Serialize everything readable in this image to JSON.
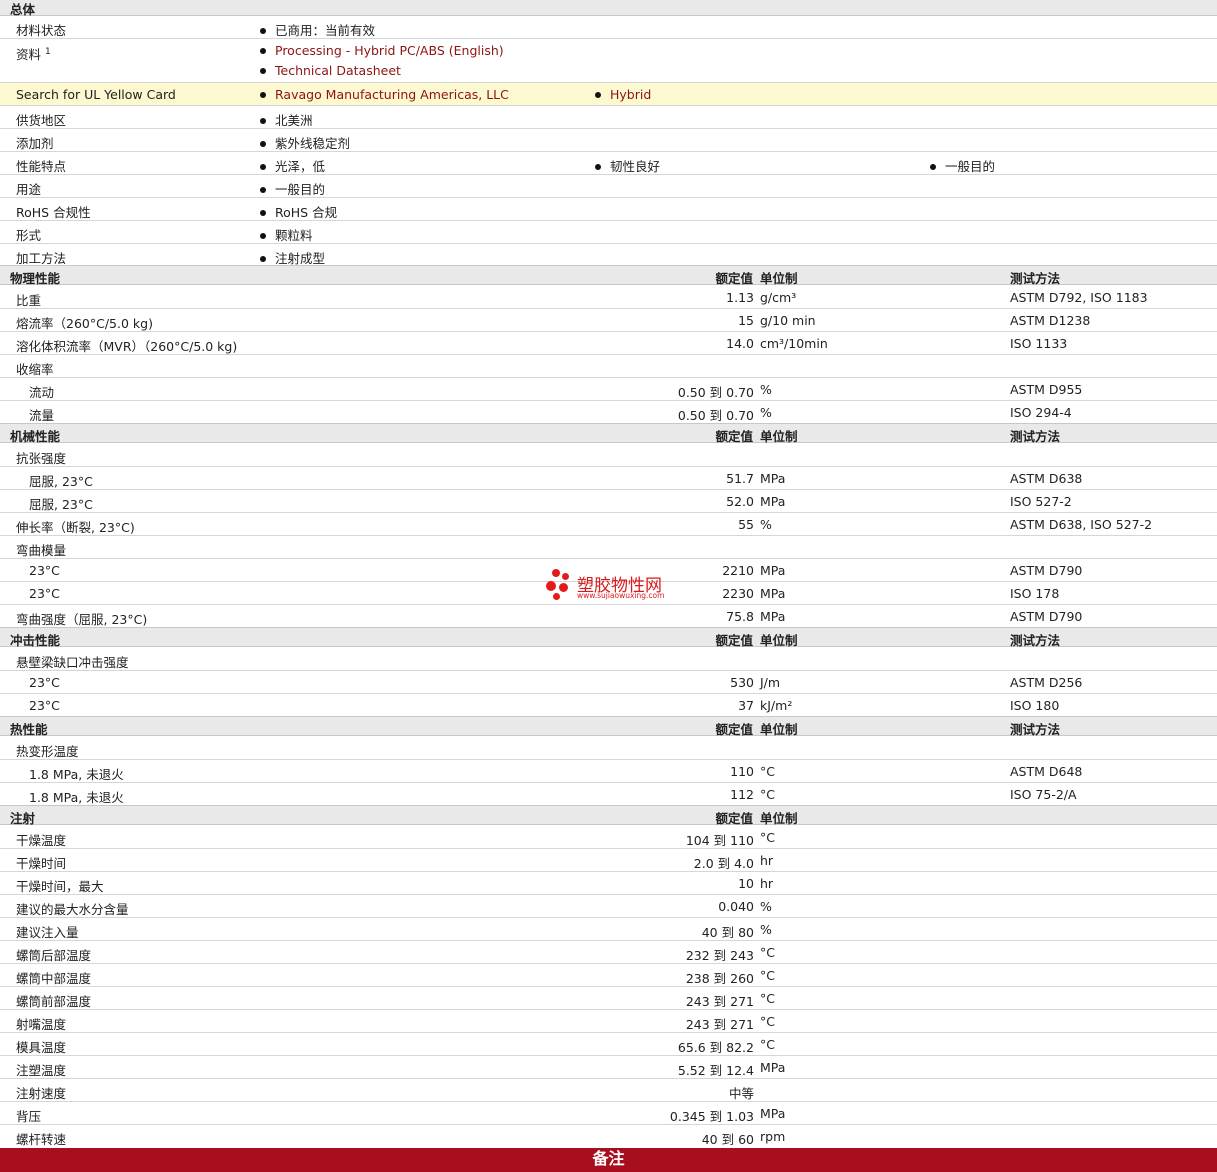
{
  "general": {
    "title": "总体",
    "material_status_label": "材料状态",
    "material_status_value": "已商用：当前有效",
    "docs_label": "资料",
    "docs_sup": "1",
    "docs": [
      "Processing - Hybrid PC/ABS (English)",
      "Technical Datasheet"
    ],
    "ul_label": "Search for UL Yellow Card",
    "ul_items": [
      "Ravago Manufacturing Americas, LLC",
      "Hybrid"
    ],
    "region_label": "供货地区",
    "region_value": "北美洲",
    "additive_label": "添加剂",
    "additive_value": "紫外线稳定剂",
    "features_label": "性能特点",
    "features": [
      "光泽，低",
      "韧性良好",
      "一般目的"
    ],
    "uses_label": "用途",
    "uses_value": "一般目的",
    "rohs_label": "RoHS 合规性",
    "rohs_value": "RoHS 合规",
    "form_label": "形式",
    "form_value": "颗粒料",
    "process_label": "加工方法",
    "process_value": "注射成型"
  },
  "headers": {
    "value": "额定值",
    "unit": "单位制",
    "method": "测试方法"
  },
  "physical": {
    "title": "物理性能",
    "rows": [
      {
        "label": "比重",
        "value": "1.13",
        "unit": "g/cm³",
        "method": "ASTM D792, ISO 1183"
      },
      {
        "label": "熔流率（260°C/5.0 kg)",
        "value": "15",
        "unit": "g/10 min",
        "method": "ASTM D1238"
      },
      {
        "label": "溶化体积流率（MVR）（260°C/5.0 kg)",
        "value": "14.0",
        "unit": "cm³/10min",
        "method": "ISO 1133"
      },
      {
        "label": "收缩率",
        "value": "",
        "unit": "",
        "method": ""
      },
      {
        "label": "流动",
        "value": "0.50 到  0.70",
        "unit": "%",
        "method": "ASTM D955"
      },
      {
        "label": "流量",
        "value": "0.50 到  0.70",
        "unit": "%",
        "method": "ISO 294-4"
      }
    ]
  },
  "mechanical": {
    "title": "机械性能",
    "rows": [
      {
        "label": "抗张强度",
        "value": "",
        "unit": "",
        "method": ""
      },
      {
        "label": "屈服, 23°C",
        "value": "51.7",
        "unit": "MPa",
        "method": "ASTM D638"
      },
      {
        "label": "屈服, 23°C",
        "value": "52.0",
        "unit": "MPa",
        "method": "ISO 527-2"
      },
      {
        "label": "伸长率（断裂, 23°C)",
        "value": "55",
        "unit": "%",
        "method": "ASTM D638, ISO 527-2"
      },
      {
        "label": "弯曲模量",
        "value": "",
        "unit": "",
        "method": ""
      },
      {
        "label": "23°C",
        "value": "2210",
        "unit": "MPa",
        "method": "ASTM D790"
      },
      {
        "label": "23°C",
        "value": "2230",
        "unit": "MPa",
        "method": "ISO 178"
      },
      {
        "label": "弯曲强度（屈服, 23°C)",
        "value": "75.8",
        "unit": "MPa",
        "method": "ASTM D790"
      }
    ]
  },
  "impact": {
    "title": "冲击性能",
    "rows": [
      {
        "label": "悬壁梁缺口冲击强度",
        "value": "",
        "unit": "",
        "method": ""
      },
      {
        "label": "23°C",
        "value": "530",
        "unit": "J/m",
        "method": "ASTM D256"
      },
      {
        "label": "23°C",
        "value": "37",
        "unit": "kJ/m²",
        "method": "ISO 180"
      }
    ]
  },
  "thermal": {
    "title": "热性能",
    "rows": [
      {
        "label": "热变形温度",
        "value": "",
        "unit": "",
        "method": ""
      },
      {
        "label": "1.8 MPa, 未退火",
        "value": "110",
        "unit": "°C",
        "method": "ASTM D648"
      },
      {
        "label": "1.8 MPa, 未退火",
        "value": "112",
        "unit": "°C",
        "method": "ISO 75-2/A"
      }
    ]
  },
  "injection": {
    "title": "注射",
    "rows": [
      {
        "label": "干燥温度",
        "value": "104 到  110",
        "unit": "°C"
      },
      {
        "label": "干燥时间",
        "value": "2.0 到  4.0",
        "unit": "hr"
      },
      {
        "label": "干燥时间，最大",
        "value": "10",
        "unit": "hr"
      },
      {
        "label": "建议的最大水分含量",
        "value": "0.040",
        "unit": "%"
      },
      {
        "label": "建议注入量",
        "value": "40 到  80",
        "unit": "%"
      },
      {
        "label": "螺筒后部温度",
        "value": "232 到  243",
        "unit": "°C"
      },
      {
        "label": "螺筒中部温度",
        "value": "238 到  260",
        "unit": "°C"
      },
      {
        "label": "螺筒前部温度",
        "value": "243 到  271",
        "unit": "°C"
      },
      {
        "label": "射嘴温度",
        "value": "243 到  271",
        "unit": "°C"
      },
      {
        "label": "模具温度",
        "value": "65.6 到  82.2",
        "unit": "°C"
      },
      {
        "label": "注塑温度",
        "value": "5.52 到  12.4",
        "unit": "MPa"
      },
      {
        "label": "注射速度",
        "value": "中等",
        "unit": ""
      },
      {
        "label": "背压",
        "value": "0.345 到  1.03",
        "unit": "MPa"
      },
      {
        "label": "螺杆转速",
        "value": "40 到  60",
        "unit": "rpm"
      }
    ]
  },
  "footer": {
    "title": "备注"
  },
  "watermark": {
    "text": "塑胶物性网",
    "url": "www.sujiaowuxing.com",
    "color": "#d81a1a"
  }
}
